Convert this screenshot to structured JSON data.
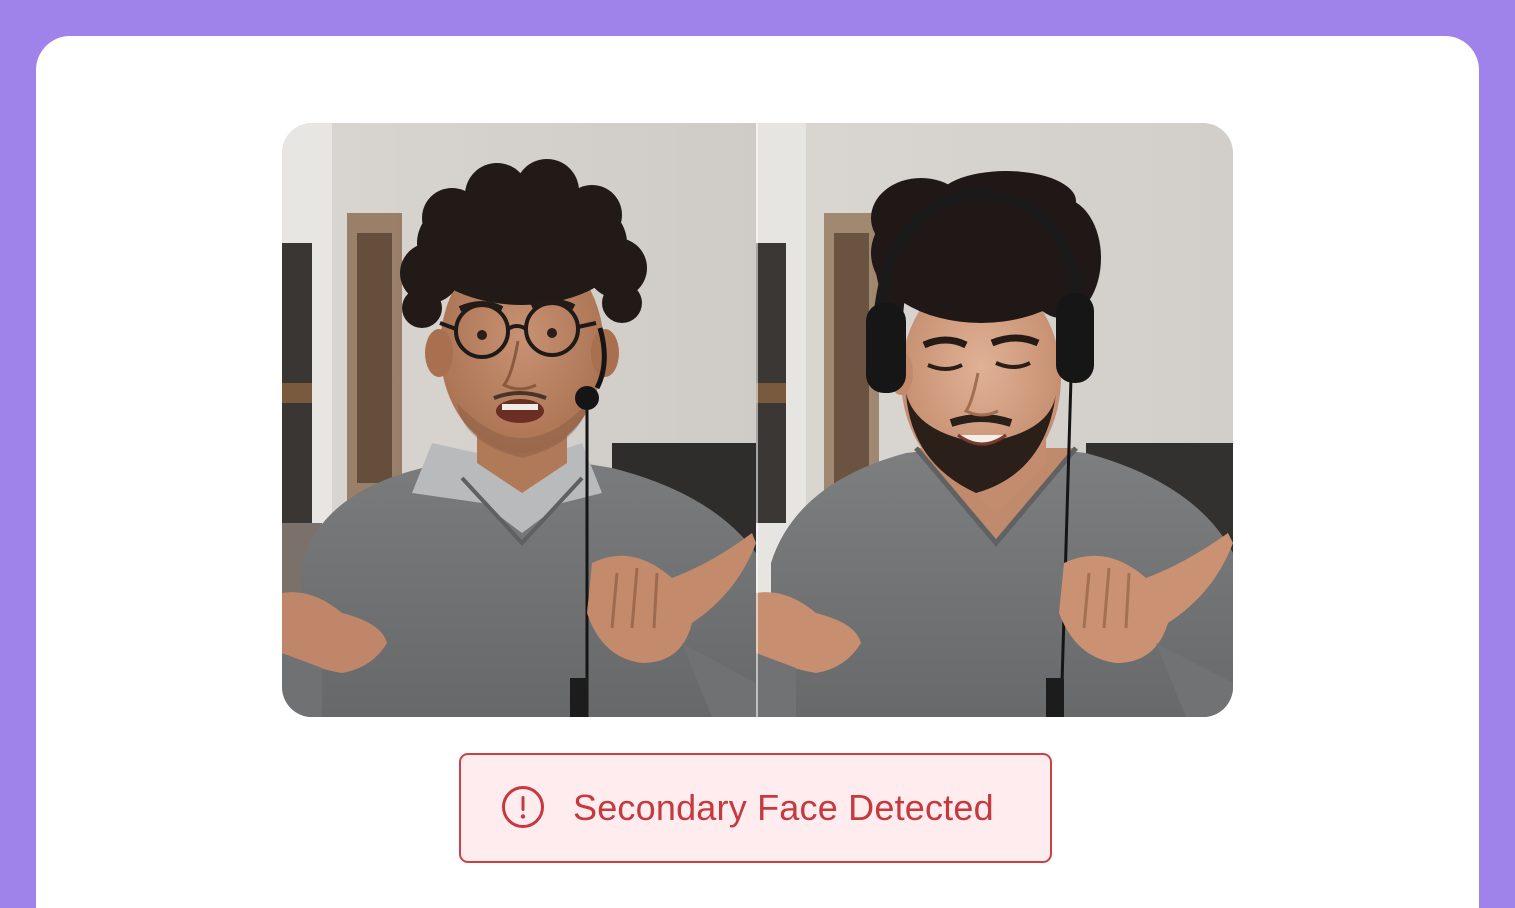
{
  "alert": {
    "icon": "exclamation-circle-icon",
    "text": "Secondary Face Detected",
    "color": "#c5393f",
    "background": "#feecee"
  },
  "video": {
    "left_panel": "original-video-frame",
    "right_panel": "face-swapped-video-frame"
  },
  "theme": {
    "frame_color": "#a083ea",
    "card_color": "#ffffff"
  }
}
